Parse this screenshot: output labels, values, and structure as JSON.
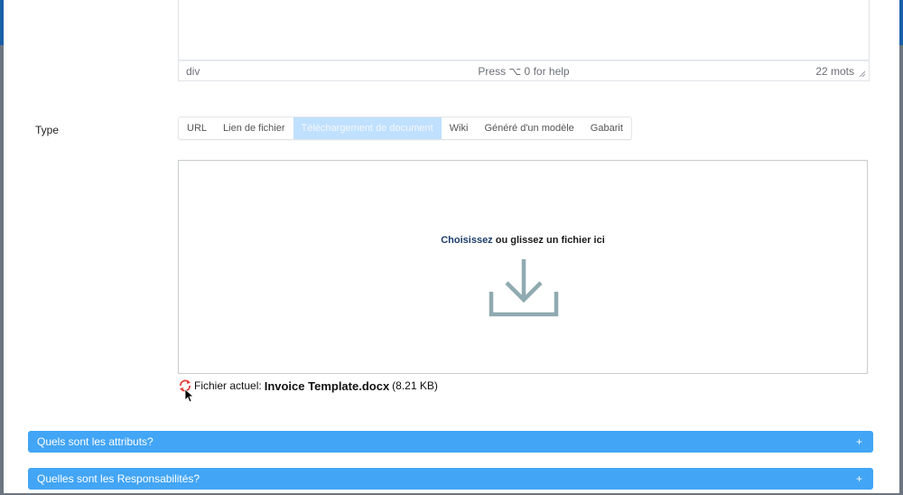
{
  "editor": {
    "path": "div",
    "help": "Press ⌥ 0 for help",
    "word_count": "22 mots"
  },
  "type_field": {
    "label": "Type",
    "tabs": [
      {
        "label": "URL",
        "active": false
      },
      {
        "label": "Lien de fichier",
        "active": false
      },
      {
        "label": "Téléchargement de document",
        "active": true
      },
      {
        "label": "Wiki",
        "active": false
      },
      {
        "label": "Généré d'un modèle",
        "active": false
      },
      {
        "label": "Gabarit",
        "active": false
      }
    ]
  },
  "dropzone": {
    "choose_label": "Choisissez",
    "drop_label": " ou glissez un fichier ici",
    "icon": "download-icon"
  },
  "current_file": {
    "label": "Fichier actuel:",
    "name": "Invoice Template.docx",
    "size": "(8.21 KB)",
    "icon": "refresh-icon"
  },
  "accordions": [
    {
      "title": "Quels sont les attributs?",
      "icon": "+"
    },
    {
      "title": "Quelles sont les Responsabilités?",
      "icon": "+"
    }
  ],
  "colors": {
    "accent": "#42a5f5",
    "active_tab": "#bfe0ff",
    "icon_gray": "#8faab0",
    "refresh_red": "#e53935"
  }
}
